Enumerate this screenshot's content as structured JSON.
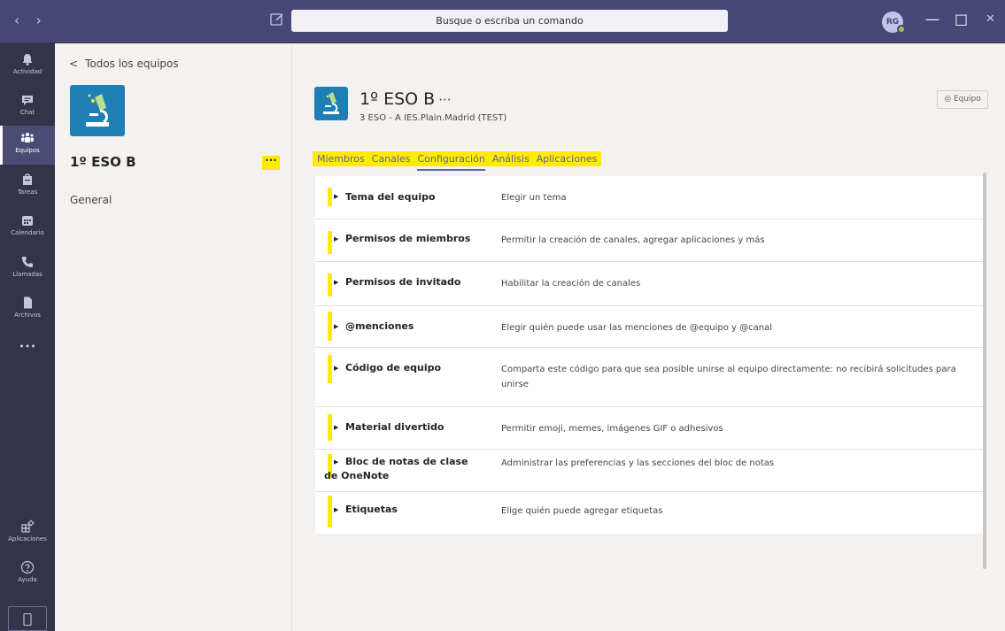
{
  "titlebar": {
    "back_glyph": "‹",
    "forward_glyph": "›",
    "search_placeholder": "Busque o escriba un comando",
    "avatar_initials": "RG",
    "minimize_glyph": "—",
    "maximize_glyph": "□",
    "close_glyph": "✕"
  },
  "rail": {
    "items": [
      {
        "label": "Actividad",
        "icon": "bell-icon"
      },
      {
        "label": "Chat",
        "icon": "chat-icon"
      },
      {
        "label": "Equipos",
        "icon": "teams-icon"
      },
      {
        "label": "Tareas",
        "icon": "assignments-icon"
      },
      {
        "label": "Calendario",
        "icon": "calendar-icon"
      },
      {
        "label": "Llamadas",
        "icon": "phone-icon"
      },
      {
        "label": "Archivos",
        "icon": "file-icon"
      }
    ],
    "more_glyph": "•••",
    "apps_label": "Aplicaciones",
    "help_label": "Ayuda"
  },
  "teampane": {
    "back_label": "Todos los equipos",
    "team_name": "1º ESO B",
    "more_glyph": "···",
    "channels": [
      "General"
    ]
  },
  "main": {
    "team_title": "1º ESO B",
    "title_more": "···",
    "team_subtitle": "3 ESO - A IES.Plain.Madrid (TEST)",
    "team_button": "Equipo",
    "tabs": [
      "Miembros",
      "Canales",
      "Configuración",
      "Análisis",
      "Aplicaciones"
    ],
    "active_tab": "Configuración",
    "settings": [
      {
        "title": "Tema del equipo",
        "desc": "Elegir un tema"
      },
      {
        "title": "Permisos de miembros",
        "desc": "Permitir la creación de canales, agregar aplicaciones y más"
      },
      {
        "title": "Permisos de invitado",
        "desc": "Habilitar la creación de canales"
      },
      {
        "title": "@menciones",
        "desc": "Elegir quién puede usar las menciones de @equipo y @canal"
      },
      {
        "title": "Código de equipo",
        "desc": "Comparta este código para que sea posible unirse al equipo directamente: no recibirá solicitudes para unirse"
      },
      {
        "title": "Material divertido",
        "desc": "Permitir emoji, memes, imágenes GIF o adhesivos"
      },
      {
        "title": "Bloc de notas de clase de OneNote",
        "desc": "Administrar las preferencias y las secciones del bloc de notas"
      },
      {
        "title": "Etiquetas",
        "desc": "Elige quién puede agregar etiquetas"
      }
    ]
  },
  "colors": {
    "titlebar": "#464775",
    "rail": "#33344a",
    "highlight": "#ffeb00",
    "accent": "#6264a7",
    "team_logo": "#1d7fb5"
  }
}
